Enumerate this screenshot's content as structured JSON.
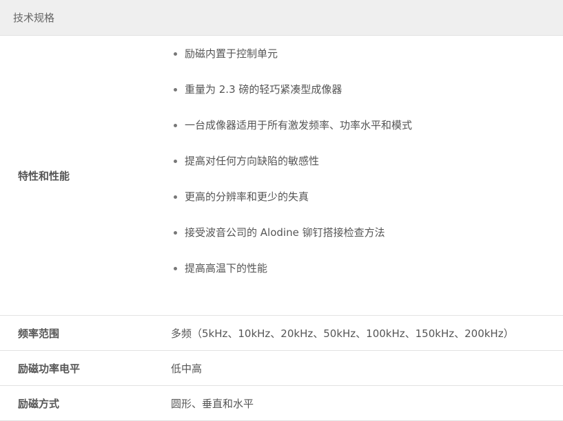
{
  "header": {
    "title": "技术规格"
  },
  "specs": {
    "features": {
      "label": "特性和性能",
      "items": [
        "励磁内置于控制单元",
        "重量为 2.3 磅的轻巧紧凑型成像器",
        "一台成像器适用于所有激发频率、功率水平和模式",
        "提高对任何方向缺陷的敏感性",
        "更高的分辨率和更少的失真",
        "接受波音公司的 Alodine 铆钉搭接检查方法",
        "提高高温下的性能"
      ]
    },
    "frequency": {
      "label": "频率范围",
      "value": "多频（5kHz、10kHz、20kHz、50kHz、100kHz、150kHz、200kHz）"
    },
    "power": {
      "label": "励磁功率电平",
      "value": "低中高"
    },
    "mode": {
      "label": "励磁方式",
      "value": "圆形、垂直和水平"
    }
  }
}
